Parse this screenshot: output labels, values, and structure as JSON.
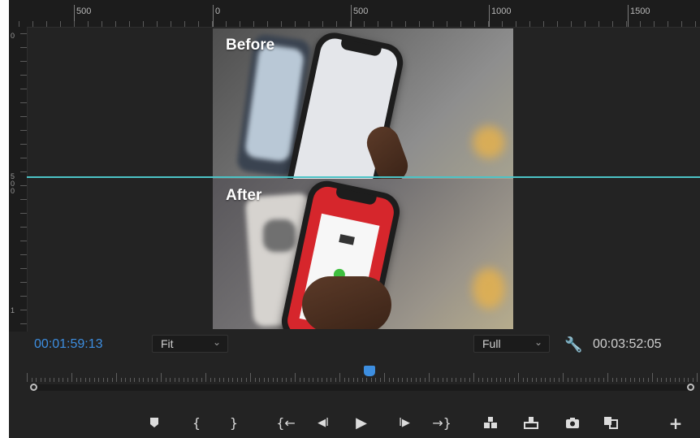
{
  "ruler": {
    "top_labels": [
      "500",
      "0",
      "500",
      "1000",
      "1500"
    ],
    "left_labels": [
      "0",
      "5\n0\n0",
      "1"
    ]
  },
  "frame": {
    "before_caption": "Before",
    "after_caption": "After"
  },
  "controls": {
    "current_timecode": "00:01:59:13",
    "zoom_value": "Fit",
    "resolution_value": "Full",
    "duration_timecode": "00:03:52:05"
  },
  "transport": [
    {
      "name": "add-marker-button",
      "icon": "marker-icon"
    },
    {
      "name": "mark-in-button",
      "icon": "mark-in-icon",
      "glyph": "{"
    },
    {
      "name": "mark-out-button",
      "icon": "mark-out-icon",
      "glyph": "}"
    },
    {
      "name": "go-to-in-button",
      "icon": "go-to-in-icon",
      "glyph": "{←"
    },
    {
      "name": "step-back-button",
      "icon": "step-back-icon",
      "glyph": "◀I"
    },
    {
      "name": "play-button",
      "icon": "play-icon",
      "glyph": "▶"
    },
    {
      "name": "step-forward-button",
      "icon": "step-forward-icon",
      "glyph": "I▶"
    },
    {
      "name": "go-to-out-button",
      "icon": "go-to-out-icon",
      "glyph": "→}"
    },
    {
      "name": "insert-button",
      "icon": "insert-icon"
    },
    {
      "name": "overwrite-button",
      "icon": "overwrite-icon"
    },
    {
      "name": "export-frame-button",
      "icon": "camera-icon"
    },
    {
      "name": "comparison-view-button",
      "icon": "comparison-view-icon"
    },
    {
      "name": "button-editor-button",
      "icon": "plus-icon",
      "glyph": "+"
    }
  ],
  "colors": {
    "accent_blue": "#3d8ee0",
    "guide_line": "#4cc3c6",
    "panel_bg": "#232323"
  }
}
